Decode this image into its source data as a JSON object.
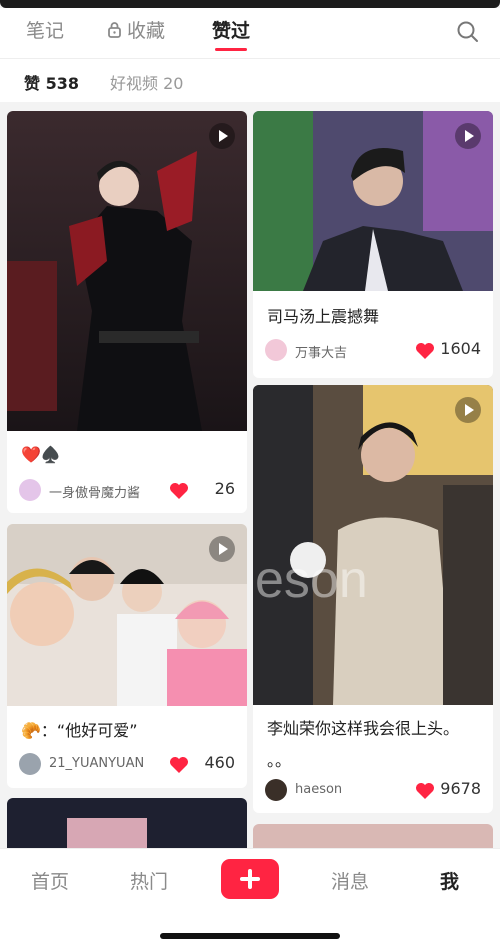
{
  "top_tabs": [
    {
      "label": "笔记",
      "active": false
    },
    {
      "label": "收藏",
      "active": false,
      "icon": "lock-icon"
    },
    {
      "label": "赞过",
      "active": true
    }
  ],
  "search_icon": "search-icon",
  "sub_tabs": [
    {
      "label": "赞 538",
      "active": true
    },
    {
      "label": "好视频 20",
      "active": false
    }
  ],
  "accent_color": "#ff2442",
  "cards": [
    {
      "title": "❤️♠️",
      "author": "一身傲骨魔力酱",
      "likes": "26",
      "is_video": true
    },
    {
      "title": "司马汤上震撼舞",
      "author": "万事大吉",
      "likes": "1604",
      "is_video": true
    },
    {
      "title": "🥐：“他好可爱”",
      "author": "21_YUANYUAN",
      "likes": "460",
      "is_video": true
    },
    {
      "title": "李灿荣你这样我会很上头。",
      "title_line2": "。。",
      "author": "haeson",
      "likes": "9678",
      "is_video": true,
      "watermark": "eson"
    }
  ],
  "bottom_nav": [
    {
      "label": "首页",
      "active": false
    },
    {
      "label": "热门",
      "active": false
    },
    {
      "label": "",
      "icon": "plus-icon"
    },
    {
      "label": "消息",
      "active": false
    },
    {
      "label": "我",
      "active": true
    }
  ]
}
